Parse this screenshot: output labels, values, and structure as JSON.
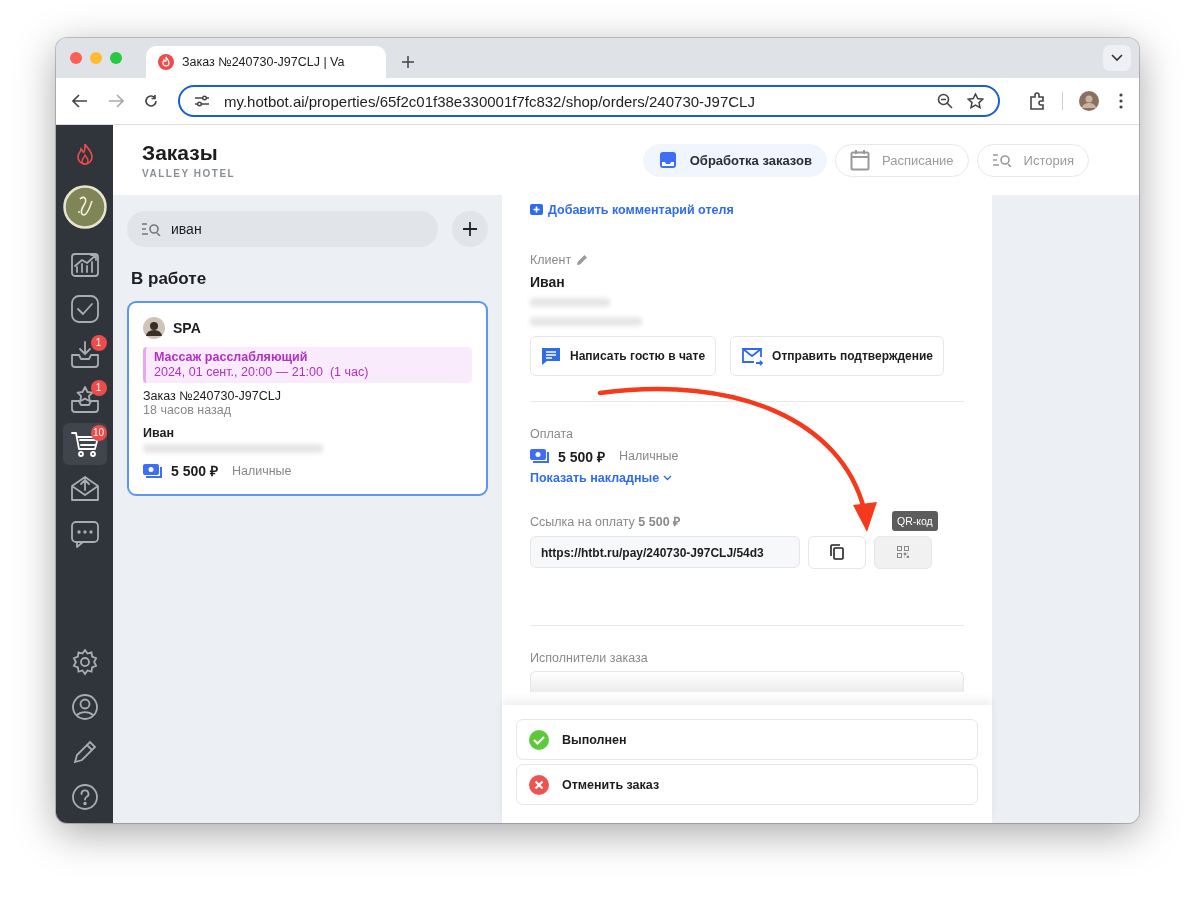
{
  "browser": {
    "tab_title": "Заказ №240730-J97CLJ | Va",
    "url": "my.hotbot.ai/properties/65f2c01f38e330001f7fc832/shop/orders/240730-J97CLJ"
  },
  "sidebar": {
    "items": [
      {
        "kind": "chart",
        "selected": false
      },
      {
        "kind": "check",
        "selected": false
      },
      {
        "kind": "inbox",
        "badge": "1",
        "selected": false
      },
      {
        "kind": "star",
        "badge": "1",
        "selected": false
      },
      {
        "kind": "cart",
        "badge": "10",
        "selected": true
      },
      {
        "kind": "mail",
        "selected": false
      },
      {
        "kind": "chat",
        "selected": false
      }
    ],
    "bottom_items": [
      {
        "kind": "settings"
      },
      {
        "kind": "user"
      },
      {
        "kind": "pencil"
      },
      {
        "kind": "help"
      }
    ]
  },
  "header": {
    "title": "Заказы",
    "subtitle": "VALLEY HOTEL",
    "tabs": [
      {
        "label": "Обработка заказов",
        "kind": "inbox",
        "selected": true
      },
      {
        "label": "Расписание",
        "kind": "calendar",
        "selected": false
      },
      {
        "label": "История",
        "kind": "history",
        "selected": false
      }
    ]
  },
  "search": {
    "value": "иван"
  },
  "section_title": "В работе",
  "orders": [
    {
      "service": "SPA",
      "event_title": "Массаж расслабляющий",
      "event_time": "2024, 01 сент., 20:00 — 21:00  (1 час)",
      "order_number": "Заказ №240730-J97CLJ",
      "ago": "18 часов назад",
      "guest": "Иван",
      "amount": "5 500 ₽",
      "method": "Наличные",
      "selected": true
    }
  ],
  "detail": {
    "add_comment": "Добавить комментарий отеля",
    "client_label": "Клиент",
    "client_name": "Иван",
    "client_buttons": [
      {
        "label": "Написать гостю в чате",
        "kind": "chat"
      },
      {
        "label": "Отправить подтверждение",
        "kind": "mail"
      }
    ],
    "payment_label": "Оплата",
    "amount": "5 500 ₽",
    "method": "Наличные",
    "invoices_link": "Показать накладные",
    "payment_link_label": "Ссылка на оплату **5 500 ₽**",
    "payment_link": "https://htbt.ru/pay/240730-J97CLJ/54d3",
    "tooltip": "QR-код",
    "executors_label": "Исполнители заказа",
    "actions": [
      {
        "label": "Выполнен",
        "kind": "done"
      },
      {
        "label": "Отменить заказ",
        "kind": "cancel"
      }
    ]
  }
}
